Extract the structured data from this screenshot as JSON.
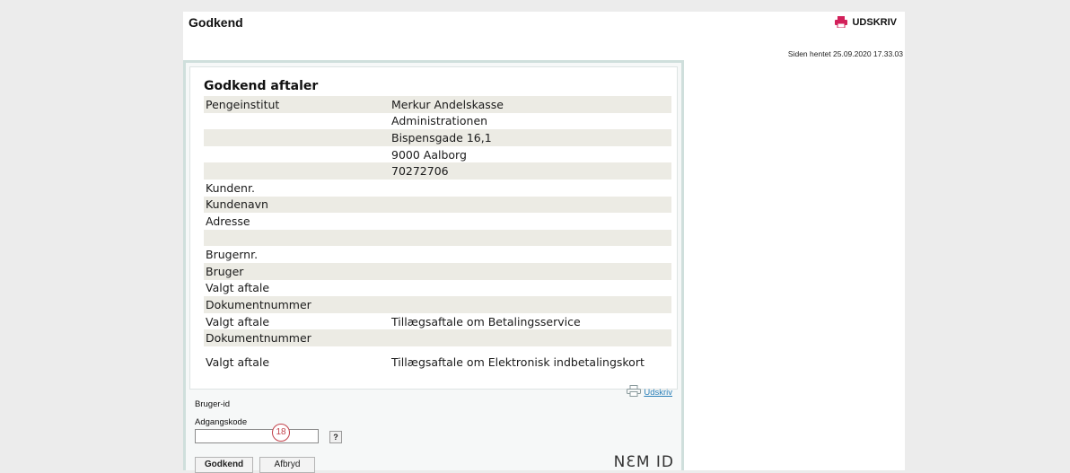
{
  "page": {
    "title": "Godkend",
    "print_label": "UDSKRIV",
    "fetched": "Siden hentet 25.09.2020 17.33.03"
  },
  "form": {
    "section_title": "Godkend aftaler",
    "rows": [
      {
        "label": "Pengeinstitut",
        "value": "Merkur Andelskasse"
      },
      {
        "label": "",
        "value": "Administrationen"
      },
      {
        "label": "",
        "value": "Bispensgade 16,1"
      },
      {
        "label": "",
        "value": "9000 Aalborg"
      },
      {
        "label": "",
        "value": "70272706"
      },
      {
        "label": "Kundenr.",
        "value": ""
      },
      {
        "label": "Kundenavn",
        "value": ""
      },
      {
        "label": "Adresse",
        "value": ""
      },
      {
        "label": "",
        "value": ""
      },
      {
        "label": "Brugernr.",
        "value": ""
      },
      {
        "label": "Bruger",
        "value": ""
      },
      {
        "label": "Valgt aftale",
        "value": ""
      },
      {
        "label": "Dokumentnummer",
        "value": ""
      },
      {
        "label": "Valgt aftale",
        "value": "Tillægsaftale om Betalingsservice"
      },
      {
        "label": "Dokumentnummer",
        "value": ""
      },
      {
        "label": "Valgt aftale",
        "value": "Tillægsaftale om Elektronisk indbetalingskort"
      }
    ],
    "print_link": "Udskriv",
    "user_id_label": "Bruger-id",
    "password_label": "Adgangskode",
    "password_value": "",
    "help_label": "?",
    "marker": "18",
    "approve_button": "Godkend",
    "cancel_button": "Afbryd",
    "nemid_logo": "NƐM ID"
  },
  "colors": {
    "row_shade": "#ecebe4",
    "frame_border": "#cfdfdc",
    "link": "#2a7fb8",
    "print_icon": "#d2205a",
    "marker": "#c2424b"
  }
}
